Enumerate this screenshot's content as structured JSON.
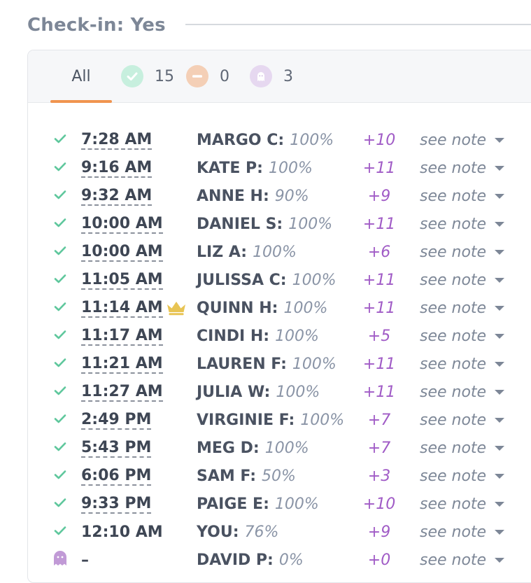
{
  "section": {
    "title": "Check-in: Yes"
  },
  "tabs": {
    "all_label": "All",
    "checked_in_count": "15",
    "declined_count": "0",
    "no_show_count": "3"
  },
  "colors": {
    "check": "#5ec79c",
    "ghost": "#c19ad6",
    "points": "#a05bc6",
    "active_tab": "#f0944f",
    "crown": "#e8c453"
  },
  "rows": [
    {
      "status": "checked",
      "time": "7:28 AM",
      "name": "MARGO C:",
      "percent": "100%",
      "points": "+10",
      "note": "see note"
    },
    {
      "status": "checked",
      "time": "9:16 AM",
      "name": "KATE P:",
      "percent": "100%",
      "points": "+11",
      "note": "see note"
    },
    {
      "status": "checked",
      "time": "9:32 AM",
      "name": "ANNE H:",
      "percent": "90%",
      "points": "+9",
      "note": "see note"
    },
    {
      "status": "checked",
      "time": "10:00 AM",
      "name": "DANIEL S:",
      "percent": "100%",
      "points": "+11",
      "note": "see note"
    },
    {
      "status": "checked",
      "time": "10:00 AM",
      "name": "LIZ A:",
      "percent": "100%",
      "points": "+6",
      "note": "see note"
    },
    {
      "status": "checked",
      "time": "11:05 AM",
      "name": "JULISSA C:",
      "percent": "100%",
      "points": "+11",
      "note": "see note"
    },
    {
      "status": "checked",
      "time": "11:14 AM",
      "name": "QUINN H:",
      "percent": "100%",
      "points": "+11",
      "note": "see note",
      "crown": true
    },
    {
      "status": "checked",
      "time": "11:17 AM",
      "name": "CINDI H:",
      "percent": "100%",
      "points": "+5",
      "note": "see note"
    },
    {
      "status": "checked",
      "time": "11:21 AM",
      "name": "LAUREN F:",
      "percent": "100%",
      "points": "+11",
      "note": "see note"
    },
    {
      "status": "checked",
      "time": "11:27 AM",
      "name": "JULIA W:",
      "percent": "100%",
      "points": "+11",
      "note": "see note"
    },
    {
      "status": "checked",
      "time": "2:49 PM",
      "name": "VIRGINIE F:",
      "percent": "100%",
      "points": "+7",
      "note": "see note"
    },
    {
      "status": "checked",
      "time": "5:43 PM",
      "name": "MEG D:",
      "percent": "100%",
      "points": "+7",
      "note": "see note"
    },
    {
      "status": "checked",
      "time": "6:06 PM",
      "name": "SAM F:",
      "percent": "50%",
      "points": "+3",
      "note": "see note"
    },
    {
      "status": "checked",
      "time": "9:33 PM",
      "name": "PAIGE E:",
      "percent": "100%",
      "points": "+10",
      "note": "see note"
    },
    {
      "status": "checked",
      "time": "12:10 AM",
      "name": "YOU:",
      "percent": "76%",
      "points": "+9",
      "note": "see note",
      "plain_time": true
    },
    {
      "status": "ghost",
      "time": "–",
      "name": "DAVID P:",
      "percent": "0%",
      "points": "+0",
      "note": "see note",
      "plain_time": true
    }
  ]
}
